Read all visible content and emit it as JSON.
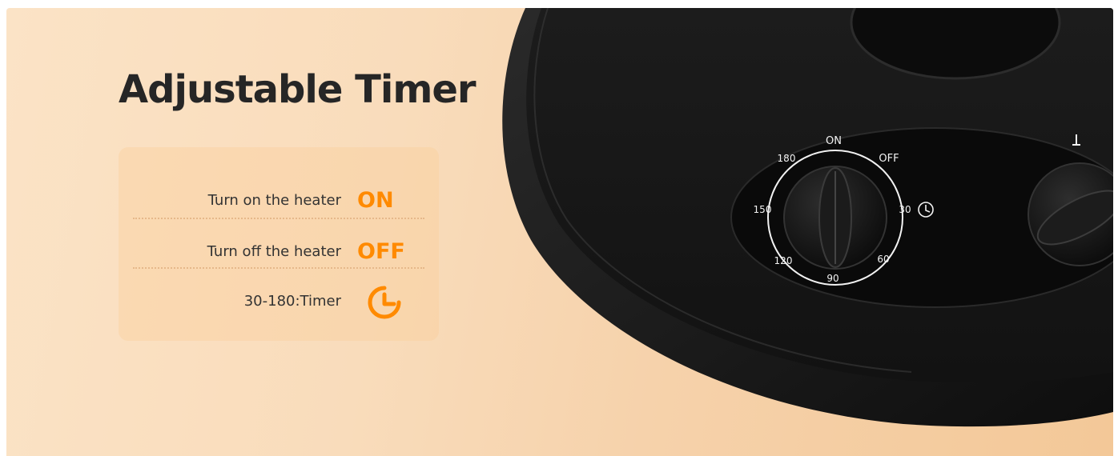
{
  "title": "Adjustable Timer",
  "legend": {
    "rows": [
      {
        "label": "Turn on the heater",
        "mark": "ON"
      },
      {
        "label": "Turn off the heater",
        "mark": "OFF"
      },
      {
        "label": "30-180:Timer",
        "mark_icon": "timer-icon"
      }
    ]
  },
  "dial": {
    "labels": [
      "ON",
      "OFF",
      "30",
      "60",
      "90",
      "120",
      "150",
      "180"
    ]
  },
  "colors": {
    "accent": "#ff8a00",
    "title": "#262626",
    "device": "#161616"
  }
}
